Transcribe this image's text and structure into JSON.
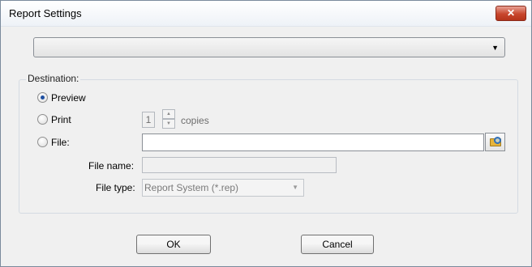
{
  "window": {
    "title": "Report Settings",
    "close_label": "✕"
  },
  "top_select": {
    "value": ""
  },
  "destination": {
    "legend": "Destination:",
    "preview_label": "Preview",
    "print_label": "Print",
    "copies_value": "1",
    "copies_label": "copies",
    "file_label": "File:",
    "file_value": "",
    "file_name_label": "File name:",
    "file_name_value": "",
    "file_type_label": "File type:",
    "file_type_value": "Report System (*.rep)",
    "selected": "Preview"
  },
  "buttons": {
    "ok_label": "OK",
    "cancel_label": "Cancel"
  },
  "icons": {
    "dropdown": "chevron-down-icon",
    "spin_up": "triangle-up-icon",
    "spin_down": "triangle-down-icon",
    "browse": "folder-search-icon"
  }
}
